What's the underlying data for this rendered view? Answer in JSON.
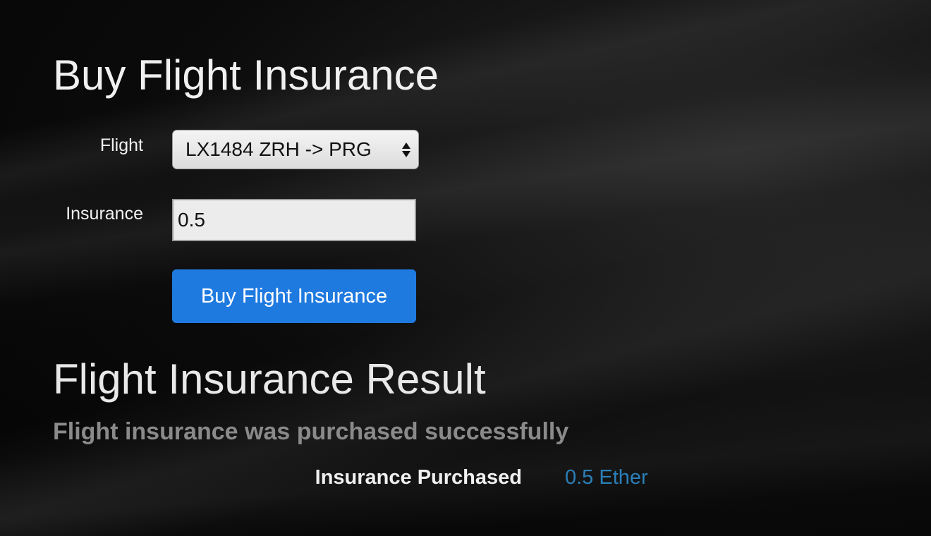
{
  "form": {
    "title": "Buy Flight Insurance",
    "flight_label": "Flight",
    "flight_selected": "LX1484 ZRH -> PRG",
    "insurance_label": "Insurance",
    "insurance_value": "0.5",
    "submit_label": "Buy Flight Insurance",
    "accent_color": "#1f7ae0"
  },
  "result": {
    "title": "Flight Insurance Result",
    "status": "Flight insurance was purchased successfully",
    "purchased_label": "Insurance Purchased",
    "purchased_value": "0.5 Ether",
    "value_color": "#2b7fb8"
  },
  "icons": {
    "select_arrows": "up-down-chevron-icon"
  }
}
